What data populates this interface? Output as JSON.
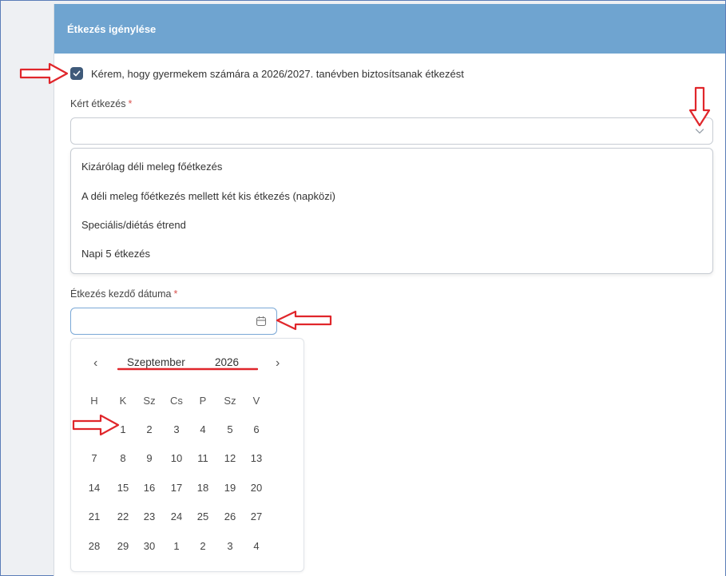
{
  "header": {
    "title": "Étkezés igénylése"
  },
  "consent": {
    "checked": true,
    "label": "Kérem, hogy gyermekem számára a 2026/2027. tanévben biztosítsanak étkezést"
  },
  "meal": {
    "label": "Kért étkezés",
    "required_mark": "*",
    "value": "",
    "options": [
      "Kizárólag déli meleg főétkezés",
      "A déli meleg főétkezés mellett két kis étkezés (napközi)",
      "Speciális/diétás étrend",
      "Napi 5 étkezés"
    ]
  },
  "start_date": {
    "label": "Étkezés kezdő dátuma",
    "required_mark": "*",
    "value": ""
  },
  "calendar": {
    "prev": "‹",
    "next": "›",
    "month": "Szeptember",
    "year": "2026",
    "weekdays": [
      "H",
      "K",
      "Sz",
      "Cs",
      "P",
      "Sz",
      "V"
    ],
    "weeks": [
      [
        "",
        "1",
        "2",
        "3",
        "4",
        "5",
        "6"
      ],
      [
        "7",
        "8",
        "9",
        "10",
        "11",
        "12",
        "13"
      ],
      [
        "14",
        "15",
        "16",
        "17",
        "18",
        "19",
        "20"
      ],
      [
        "21",
        "22",
        "23",
        "24",
        "25",
        "26",
        "27"
      ],
      [
        "28",
        "29",
        "30",
        "1",
        "2",
        "3",
        "4"
      ]
    ]
  },
  "colors": {
    "header": "#6fa4d0",
    "annotation": "#e0262b",
    "checkbox": "#3f5a7a"
  },
  "icons": {
    "checkbox": "check-icon",
    "select": "chevron-down-icon",
    "date": "calendar-icon"
  }
}
